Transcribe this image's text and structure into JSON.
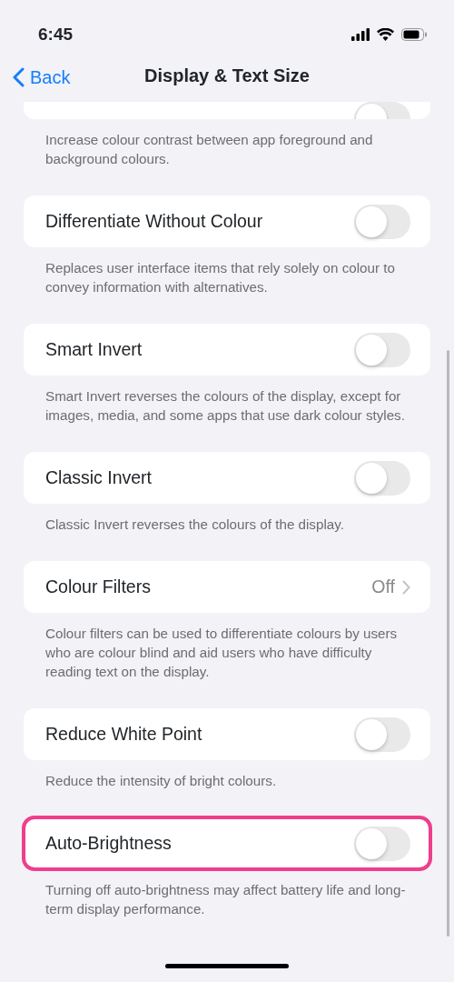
{
  "status_bar": {
    "time": "6:45"
  },
  "nav": {
    "back": "Back",
    "title": "Display & Text Size"
  },
  "sections": [
    {
      "cut_off": true,
      "row": {
        "kind": "toggle",
        "on": false
      },
      "caption": "Increase colour contrast between app foreground and background colours."
    },
    {
      "row": {
        "kind": "toggle",
        "label": "Differentiate Without Colour",
        "on": false
      },
      "caption": "Replaces user interface items that rely solely on colour to convey information with alternatives."
    },
    {
      "row": {
        "kind": "toggle",
        "label": "Smart Invert",
        "on": false
      },
      "caption": "Smart Invert reverses the colours of the display, except for images, media, and some apps that use dark colour styles."
    },
    {
      "row": {
        "kind": "toggle",
        "label": "Classic Invert",
        "on": false
      },
      "caption": "Classic Invert reverses the colours of the display."
    },
    {
      "row": {
        "kind": "link",
        "label": "Colour Filters",
        "value": "Off"
      },
      "caption": "Colour filters can be used to differentiate colours by users who are colour blind and aid users who have difficulty reading text on the display."
    },
    {
      "row": {
        "kind": "toggle",
        "label": "Reduce White Point",
        "on": false
      },
      "caption": "Reduce the intensity of bright colours."
    },
    {
      "highlighted": true,
      "row": {
        "kind": "toggle",
        "label": "Auto-Brightness",
        "on": false
      },
      "caption": "Turning off auto-brightness may affect battery life and long-term display performance."
    }
  ]
}
